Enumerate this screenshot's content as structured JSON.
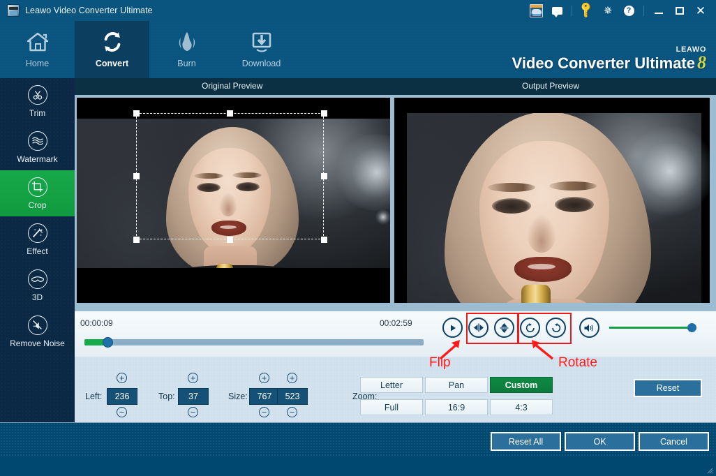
{
  "window": {
    "title": "Leawo Video Converter Ultimate",
    "app_icon": "film-clapper-icon",
    "title_buttons": [
      {
        "name": "promo-icon",
        "label": ""
      },
      {
        "name": "chat-icon",
        "label": ""
      },
      {
        "name": "key-icon",
        "label": ""
      },
      {
        "name": "gear-icon",
        "label": ""
      },
      {
        "name": "help-icon",
        "label": "?"
      },
      {
        "name": "minimize-icon",
        "label": ""
      },
      {
        "name": "maximize-icon",
        "label": ""
      },
      {
        "name": "close-icon",
        "label": "✕"
      }
    ]
  },
  "nav": {
    "items": [
      {
        "label": "Home",
        "icon": "home-icon",
        "active": false
      },
      {
        "label": "Convert",
        "icon": "convert-icon",
        "active": true
      },
      {
        "label": "Burn",
        "icon": "flame-icon",
        "active": false
      },
      {
        "label": "Download",
        "icon": "download-icon",
        "active": false
      }
    ]
  },
  "brand": {
    "vendor": "LEAWO",
    "product": "Video Converter Ultimate",
    "version": "8"
  },
  "sidebar": {
    "items": [
      {
        "label": "Trim",
        "icon": "scissors-icon",
        "active": false
      },
      {
        "label": "Watermark",
        "icon": "waves-icon",
        "active": false
      },
      {
        "label": "Crop",
        "icon": "crop-icon",
        "active": true
      },
      {
        "label": "Effect",
        "icon": "magic-wand-icon",
        "active": false
      },
      {
        "label": "3D",
        "icon": "glasses-3d-icon",
        "active": false
      },
      {
        "label": "Remove Noise",
        "icon": "noise-off-icon",
        "active": false
      }
    ]
  },
  "preview": {
    "original_label": "Original Preview",
    "output_label": "Output Preview"
  },
  "transport": {
    "current_time": "00:00:09",
    "total_time": "00:02:59",
    "seek_percent": 5,
    "volume_percent": 100,
    "buttons": [
      {
        "name": "play-button",
        "icon": "play-icon"
      },
      {
        "name": "flip-horizontal-button",
        "icon": "flip-horizontal-icon"
      },
      {
        "name": "flip-vertical-button",
        "icon": "flip-vertical-icon"
      },
      {
        "name": "rotate-clockwise-button",
        "icon": "rotate-cw-icon"
      },
      {
        "name": "rotate-counterclockwise-button",
        "icon": "rotate-ccw-icon"
      },
      {
        "name": "volume-button",
        "icon": "speaker-icon"
      }
    ]
  },
  "annotations": {
    "flip": "Flip",
    "rotate": "Rotate",
    "color": "#ff1a1a"
  },
  "params": {
    "left_label": "Left:",
    "left_value": "236",
    "top_label": "Top:",
    "top_value": "37",
    "size_label": "Size:",
    "size_width": "767",
    "size_height": "523",
    "zoom_label": "Zoom:",
    "zoom_options": [
      {
        "label": "Letter",
        "selected": false
      },
      {
        "label": "Pan",
        "selected": false
      },
      {
        "label": "Custom",
        "selected": true
      },
      {
        "label": "Full",
        "selected": false
      },
      {
        "label": "16:9",
        "selected": false
      },
      {
        "label": "4:3",
        "selected": false
      }
    ],
    "reset_label": "Reset"
  },
  "footer": {
    "reset_all": "Reset All",
    "ok": "OK",
    "cancel": "Cancel"
  },
  "colors": {
    "titlebar": "#0a5480",
    "sidebar": "#0b2944",
    "accent_green": "#17a94a",
    "panel": "#d0e0ec",
    "button_blue": "#2b6f9c",
    "annotation_red": "#ff1a1a"
  }
}
